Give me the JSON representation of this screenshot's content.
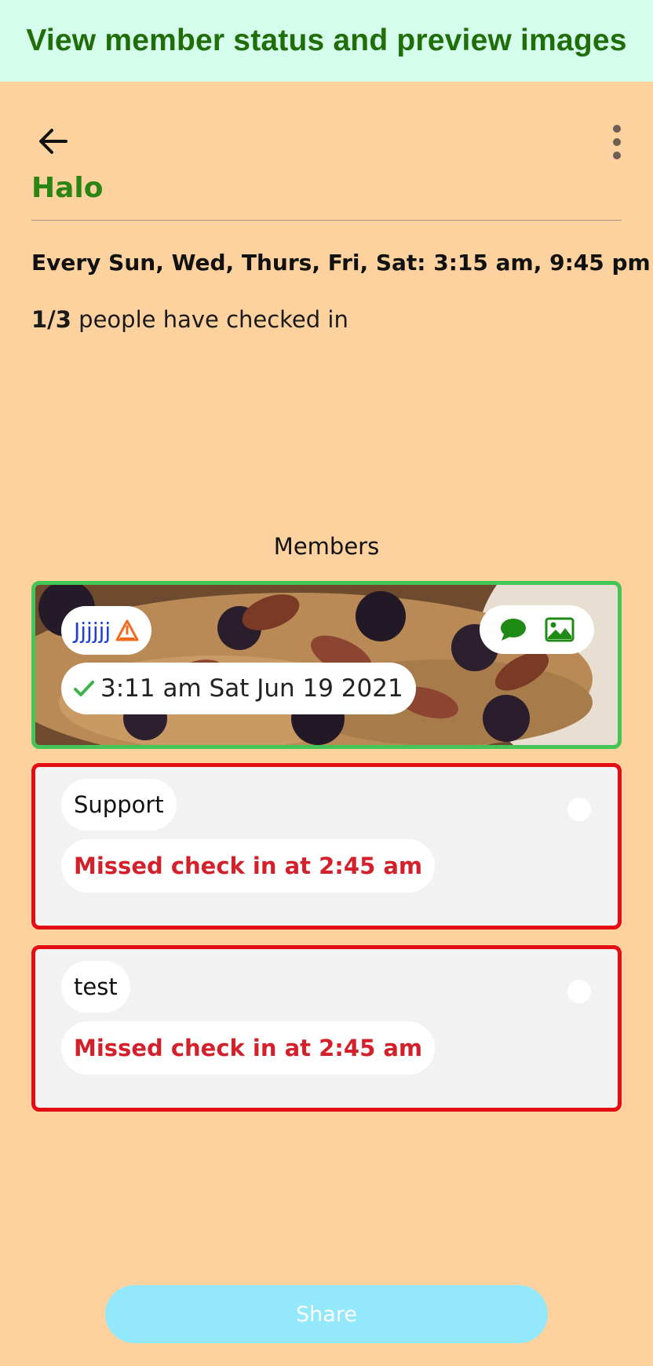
{
  "banner": {
    "text": "View member status and preview images"
  },
  "header": {
    "back_icon": "arrow-left-icon",
    "menu_icon": "more-vertical-icon",
    "group_name": "Halo"
  },
  "schedule": {
    "text": "Every Sun, Wed, Thurs, Fri, Sat: 3:15 am, 9:45 pm"
  },
  "checkin": {
    "count": "1/3",
    "suffix": " people have checked in"
  },
  "members": {
    "heading": "Members",
    "items": [
      {
        "name": "Jjjjjj",
        "status": "checked",
        "time": "3:11 am Sat Jun 19 2021",
        "badge_icon": "warning-triangle-icon",
        "check_icon": "checkmark-icon",
        "actions": [
          "chat-bubble-icon",
          "image-icon"
        ]
      },
      {
        "name": "Support",
        "status": "missed",
        "message": "Missed check in at 2:45 am"
      },
      {
        "name": "test",
        "status": "missed",
        "message": "Missed check in at 2:45 am"
      }
    ]
  },
  "share": {
    "label": "Share"
  },
  "colors": {
    "background": "#FDD29F",
    "banner_bg": "#D5FDEC",
    "banner_text": "#1F6E0A",
    "title_green": "#2A8512",
    "checked_border": "#45C457",
    "missed_border": "#E20E13",
    "missed_text": "#D3212B",
    "share_bg": "#93E8FB"
  }
}
